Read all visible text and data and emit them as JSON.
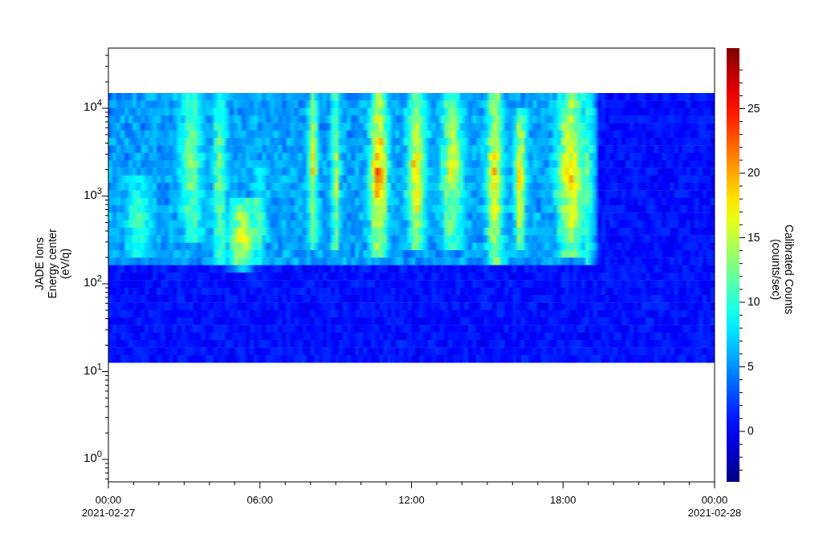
{
  "plot": {
    "ylabel_lines": [
      "JADE Ions",
      "Energy center",
      "(eV/q)"
    ],
    "yticks": [
      "10$^{4}$",
      "10$^{3}$",
      "10$^{2}$",
      "10$^{1}$",
      "10$^{0}$"
    ],
    "xticks": [
      {
        "time": "00:00",
        "date": "2021-02-27"
      },
      {
        "time": "06:00"
      },
      {
        "time": "12:00"
      },
      {
        "time": "18:00"
      },
      {
        "time": "00:00",
        "date": "2021-02-28"
      }
    ],
    "colorbar": {
      "label_lines": [
        "Calibrated Counts",
        "(counts/sec)"
      ],
      "ticks": [
        "25",
        "20",
        "15",
        "10",
        "5",
        "0"
      ]
    }
  }
}
